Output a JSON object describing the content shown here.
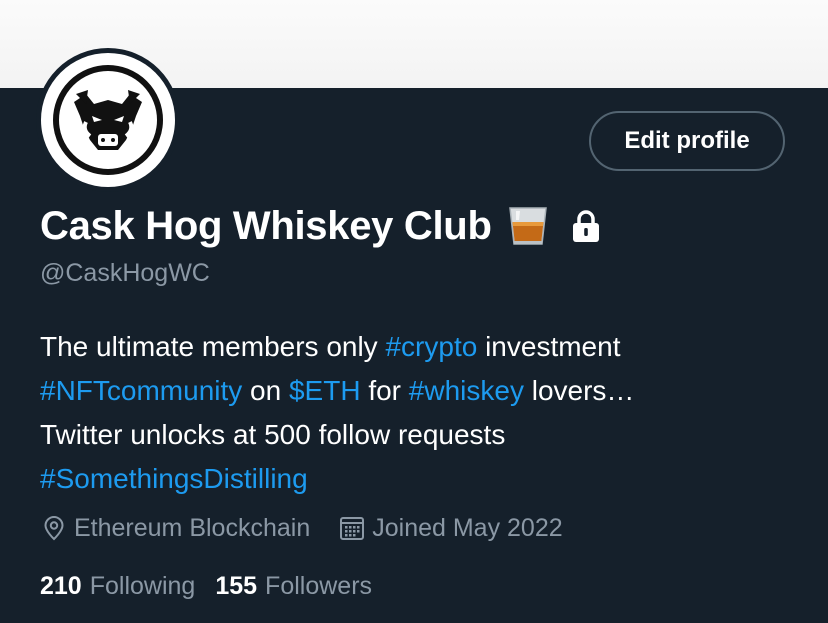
{
  "profile": {
    "display_name": "Cask Hog Whiskey Club",
    "handle": "@CaskHogWC",
    "edit_button_label": "Edit profile",
    "bio": {
      "line1": [
        {
          "text": "The ultimate members only ",
          "type": "text"
        },
        {
          "text": "#crypto",
          "type": "tag"
        },
        {
          "text": " investment",
          "type": "text"
        }
      ],
      "line2": [
        {
          "text": "#NFTcommunity",
          "type": "tag"
        },
        {
          "text": " on ",
          "type": "text"
        },
        {
          "text": "$ETH",
          "type": "tag"
        },
        {
          "text": " for ",
          "type": "text"
        },
        {
          "text": "#whiskey",
          "type": "tag"
        },
        {
          "text": " lovers…",
          "type": "text"
        }
      ],
      "line3": [
        {
          "text": "Twitter unlocks at 500 follow requests",
          "type": "text"
        }
      ],
      "line4": [
        {
          "text": "#SomethingsDistilling",
          "type": "tag"
        }
      ]
    },
    "location": "Ethereum Blockchain",
    "joined": "Joined May 2022",
    "following_count": "210",
    "following_label": "Following",
    "followers_count": "155",
    "followers_label": "Followers"
  },
  "icons": {
    "avatar": "boar-head-logo",
    "name_emoji": "tumbler-glass-icon",
    "protected": "lock-icon",
    "location": "location-pin-icon",
    "joined": "calendar-icon"
  },
  "colors": {
    "background": "#15202b",
    "banner": "#f5f5f5",
    "link": "#1d9bf0",
    "secondary_text": "#8b98a5",
    "button_border": "#536471"
  }
}
